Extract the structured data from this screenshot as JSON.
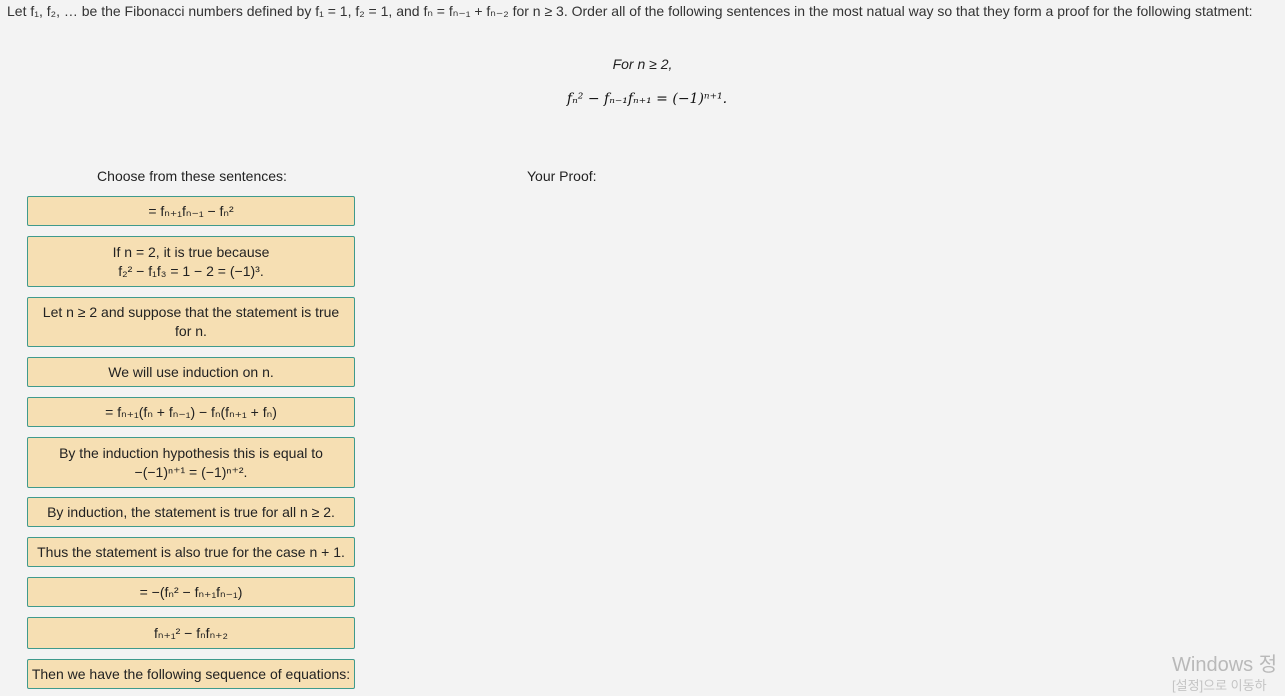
{
  "intro": {
    "text": "Let f₁, f₂, … be the Fibonacci numbers defined by f₁ = 1, f₂ = 1, and fₙ = fₙ₋₁ + fₙ₋₂ for n ≥ 3. Order all of the following sentences in the most natual way so that they form a proof for the following statment:"
  },
  "statement": {
    "condition": "For n ≥ 2,",
    "equation": "fₙ² − fₙ₋₁fₙ₊₁ = (−1)ⁿ⁺¹."
  },
  "choices_heading": "Choose from these sentences:",
  "proof_heading": "Your Proof:",
  "cards": [
    {
      "lines": [
        "= fₙ₊₁fₙ₋₁ − fₙ²"
      ]
    },
    {
      "lines": [
        "If n = 2, it is true because",
        "f₂² − f₁f₃ = 1 − 2 = (−1)³."
      ]
    },
    {
      "lines": [
        "Let n ≥ 2 and suppose that the statement is true",
        "for n."
      ]
    },
    {
      "lines": [
        "We will use induction on n."
      ]
    },
    {
      "lines": [
        "= fₙ₊₁(fₙ + fₙ₋₁) − fₙ(fₙ₊₁ + fₙ)"
      ]
    },
    {
      "lines": [
        "By the induction hypothesis this is equal to",
        "−(−1)ⁿ⁺¹ = (−1)ⁿ⁺²."
      ]
    },
    {
      "lines": [
        "By induction, the statement is true for all n ≥ 2."
      ]
    },
    {
      "lines": [
        "Thus the statement is also true for the case n + 1."
      ]
    },
    {
      "lines": [
        "= −(fₙ² − fₙ₊₁fₙ₋₁)"
      ]
    },
    {
      "lines": [
        "fₙ₊₁² − fₙfₙ₊₂"
      ]
    },
    {
      "lines": [
        "Then we have the following sequence of equations:"
      ]
    }
  ],
  "watermark": {
    "title": "Windows 정",
    "subtitle": "[설정]으로 이동하"
  }
}
